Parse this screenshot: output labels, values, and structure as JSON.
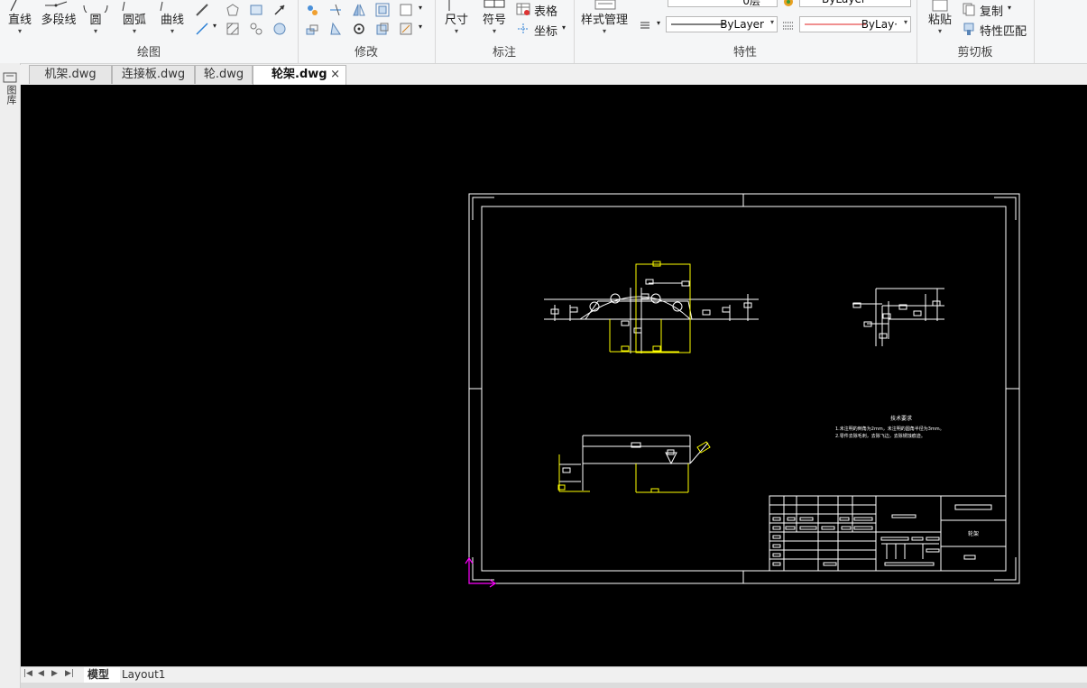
{
  "ribbon": {
    "draw": {
      "title": "绘图",
      "line": "直线",
      "polyline": "多段线",
      "circle": "圆",
      "arc": "圆弧",
      "curve": "曲线"
    },
    "modify": {
      "title": "修改"
    },
    "annotate": {
      "title": "标注",
      "dimension": "尺寸",
      "symbol": "符号",
      "table": "表格",
      "coordinate": "坐标"
    },
    "properties": {
      "title": "特性",
      "style_manager": "样式管理",
      "linetype": "ByLayer",
      "color": "ByLay·",
      "top_color": "ByLayer"
    },
    "clipboard": {
      "title": "剪切板",
      "paste": "粘贴",
      "copy": "复制",
      "match_props": "特性匹配"
    }
  },
  "left_strip": {
    "label": "图库"
  },
  "file_tabs": [
    {
      "label": "机架.dwg",
      "active": false
    },
    {
      "label": "连接板.dwg",
      "active": false
    },
    {
      "label": "轮.dwg",
      "active": false
    },
    {
      "label": "轮架.dwg",
      "active": true
    }
  ],
  "close_glyph": "×",
  "drawing": {
    "notes_title": "技术要求",
    "notes_line1": "1.未注明的倒角为2mm，未注明的圆角半径为3mm。",
    "notes_line2": "2.零件去除毛刺，去除飞边，去除锈蚀痕迹。",
    "part_name": "轮架",
    "colors": {
      "background": "#000000",
      "outline": "#ffffff",
      "dimension": "#ffff00",
      "ucs": "#ff00ff"
    }
  },
  "layout_tabs": [
    {
      "label": "模型",
      "active": true
    },
    {
      "label": "Layout1",
      "active": false
    }
  ]
}
